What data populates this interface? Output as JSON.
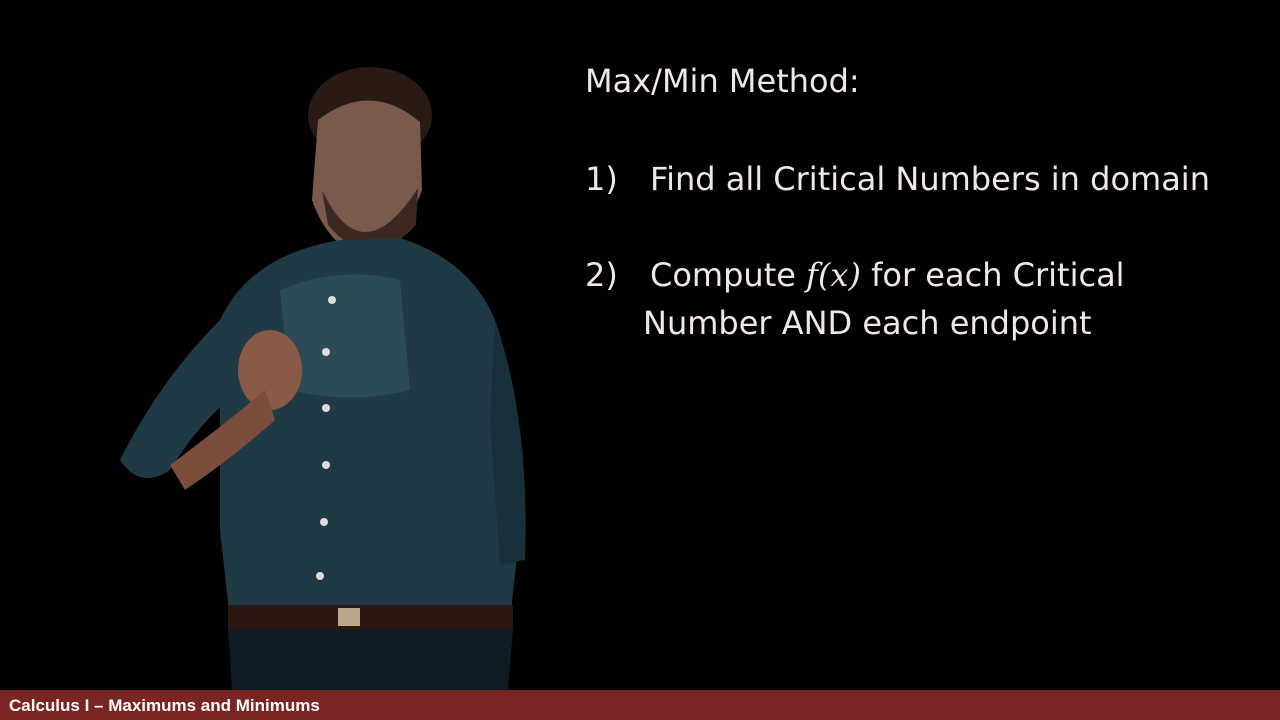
{
  "slide": {
    "title": "Max/Min Method:",
    "steps": [
      {
        "number": "1)",
        "text": "Find all Critical Numbers in domain"
      },
      {
        "number": "2)",
        "text_before": "Compute ",
        "math": "f(x)",
        "text_after": " for each Critical",
        "continuation": "Number AND each endpoint"
      }
    ]
  },
  "footer": {
    "text": "Calculus I – Maximums and Minimums"
  },
  "colors": {
    "background": "#000000",
    "footer": "#7b2424",
    "text": "#f1e8e6"
  }
}
